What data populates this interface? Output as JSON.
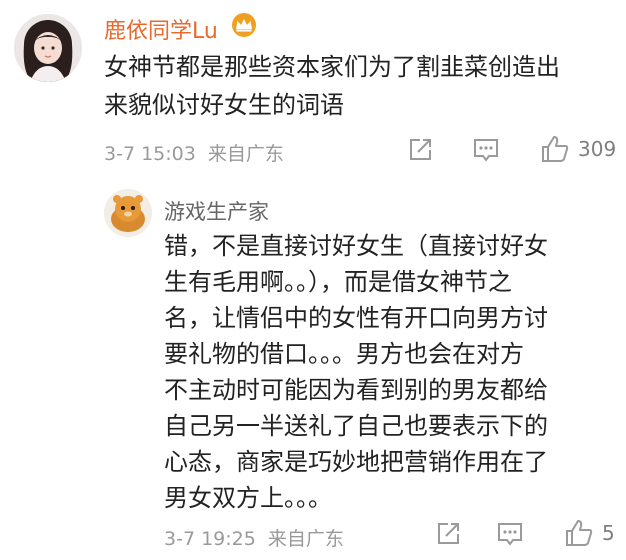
{
  "comments": [
    {
      "username": "鹿依同学Lu",
      "has_vip_crown": true,
      "text_lines": [
        "女神节都是那些资本家们为了割韭菜创造出",
        "来貌似讨好女生的词语"
      ],
      "time": "3-7 15:03",
      "location": "来自广东",
      "likes": "309"
    },
    {
      "username": "游戏生产家",
      "has_vip_crown": false,
      "text_lines": [
        "错，不是直接讨好女生（直接讨好女",
        "生有毛用啊。。），而是借女神节之",
        "名，让情侣中的女性有开口向男方讨",
        "要礼物的借口。。。男方也会在对方",
        "不主动时可能因为看到别的男友都给",
        "自己另一半送礼了自己也要表示下的",
        "心态，商家是巧妙地把营销作用在了",
        "男女双方上。。。"
      ],
      "time": "3-7 19:25",
      "location": "来自广东",
      "likes": "5"
    }
  ],
  "icons": {
    "share": "share-icon",
    "comment": "comment-icon",
    "like": "thumbs-up-icon",
    "crown": "vip-crown-icon"
  },
  "colors": {
    "username_main": "#e86a2e",
    "username_reply": "#666666",
    "body_text": "#222222",
    "meta_text": "#9a9a9a",
    "crown": "#f0a020"
  }
}
